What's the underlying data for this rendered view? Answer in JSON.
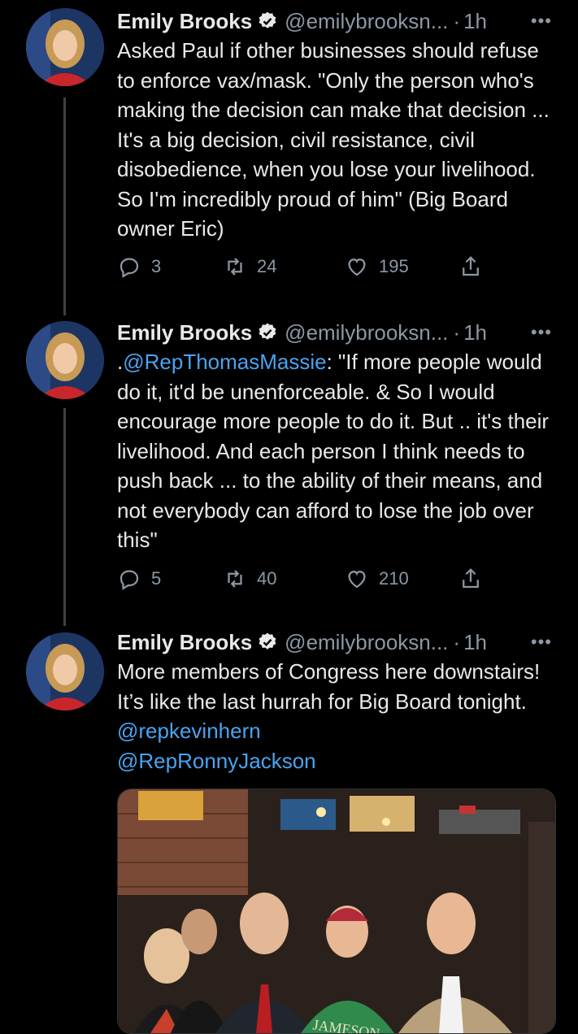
{
  "tweets": [
    {
      "name": "Emily Brooks",
      "handle": "@emilybrooksn...",
      "dot": "·",
      "time": "1h",
      "text_parts": [
        "Asked Paul if other businesses should refuse to enforce vax/mask. \"Only the person who's making the decision can make that decision ... It's a big decision, civil resistance, civil disobedience, when you lose your livelihood. So I'm incredibly proud of him\" (Big Board owner Eric)"
      ],
      "replies": "3",
      "retweets": "24",
      "likes": "195"
    },
    {
      "name": "Emily Brooks",
      "handle": "@emilybrooksn...",
      "dot": "·",
      "time": "1h",
      "text_prefix": ".",
      "mention": "@RepThomasMassie",
      "text_rest": ": \"If more people would do it, it'd be unenforceable. & So I would encourage more people to do it. But .. it's their livelihood. And each person I think needs to push back ... to the ability of their means, and not everybody can afford to lose the job over this\"",
      "replies": "5",
      "retweets": "40",
      "likes": "210"
    },
    {
      "name": "Emily Brooks",
      "handle": "@emilybrooksn...",
      "dot": "·",
      "time": "1h",
      "text": "More members of Congress here downstairs! It’s like the last hurrah for Big Board tonight. ",
      "mention1": "@repkevinhern",
      "mention2": "@RepRonnyJackson",
      "photo_text": "JAMESON"
    }
  ],
  "more_label": "•••",
  "icons": {
    "reply": "reply-icon",
    "retweet": "retweet-icon",
    "like": "heart-icon",
    "share": "share-icon",
    "verified": "verified-badge-icon"
  },
  "colors": {
    "background": "#000000",
    "text": "#e7e9ea",
    "secondary": "#8b98a5",
    "link": "#4aa3f0",
    "thread_line": "#3e4144"
  }
}
